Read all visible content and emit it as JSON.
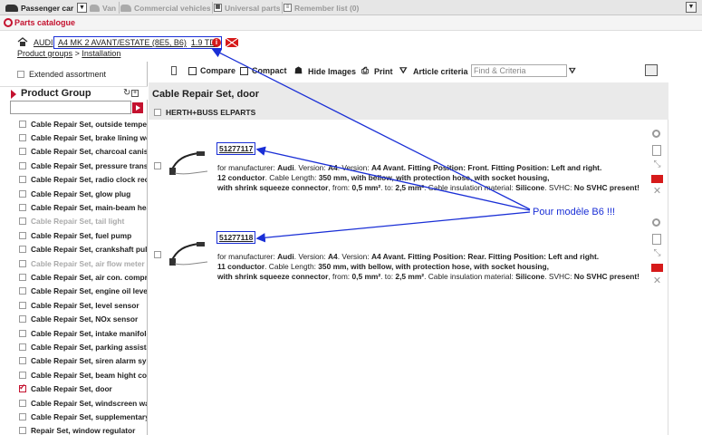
{
  "tabs": [
    {
      "label": "Passenger car",
      "active": true
    },
    {
      "label": "Van",
      "active": false
    },
    {
      "label": "Commercial vehicles",
      "active": false
    },
    {
      "label": "Universal parts",
      "active": false
    },
    {
      "label": "Remember list (0)",
      "active": false
    }
  ],
  "catalogue": {
    "label": "Parts catalogue"
  },
  "breadcrumb": {
    "make": "AUDI",
    "model": "A4 MK 2 AVANT/ESTATE (8E5, B6)",
    "engine": "1.9 TDI",
    "product_groups": "Product groups",
    "separator": ">",
    "installation": "Installation"
  },
  "sidebar": {
    "extended_assortment": "Extended assortment",
    "product_group_title": "Product Group",
    "filter_value": "",
    "items": [
      {
        "label": "Cable Repair Set, outside temperature",
        "dim": false,
        "checked": false
      },
      {
        "label": "Cable Repair Set, brake lining wear",
        "dim": false,
        "checked": false
      },
      {
        "label": "Cable Repair Set, charcoal canister",
        "dim": false,
        "checked": false
      },
      {
        "label": "Cable Repair Set, pressure transducer",
        "dim": false,
        "checked": false
      },
      {
        "label": "Cable Repair Set, radio clock receiver",
        "dim": false,
        "checked": false
      },
      {
        "label": "Cable Repair Set, glow plug",
        "dim": false,
        "checked": false
      },
      {
        "label": "Cable Repair Set, main-beam headlight",
        "dim": false,
        "checked": false
      },
      {
        "label": "Cable Repair Set, tail light",
        "dim": true,
        "checked": false
      },
      {
        "label": "Cable Repair Set, fuel pump",
        "dim": false,
        "checked": false
      },
      {
        "label": "Cable Repair Set, crankshaft pulse sensor",
        "dim": false,
        "checked": false
      },
      {
        "label": "Cable Repair Set, air flow meter",
        "dim": true,
        "checked": false
      },
      {
        "label": "Cable Repair Set, air con. compressor",
        "dim": false,
        "checked": false
      },
      {
        "label": "Cable Repair Set, engine oil level",
        "dim": false,
        "checked": false
      },
      {
        "label": "Cable Repair Set, level sensor",
        "dim": false,
        "checked": false
      },
      {
        "label": "Cable Repair Set, NOx sensor",
        "dim": false,
        "checked": false
      },
      {
        "label": "Cable Repair Set, intake manifold",
        "dim": false,
        "checked": false
      },
      {
        "label": "Cable Repair Set, parking assistant",
        "dim": false,
        "checked": false
      },
      {
        "label": "Cable Repair Set, siren alarm system",
        "dim": false,
        "checked": false
      },
      {
        "label": "Cable Repair Set, beam hight control",
        "dim": false,
        "checked": false
      },
      {
        "label": "Cable Repair Set, door",
        "dim": false,
        "checked": true
      },
      {
        "label": "Cable Repair Set, windscreen washer",
        "dim": false,
        "checked": false
      },
      {
        "label": "Cable Repair Set, supplementary",
        "dim": false,
        "checked": false
      },
      {
        "label": "Repair Set, window regulator",
        "dim": false,
        "checked": false
      }
    ]
  },
  "toolbar": {
    "compare": "Compare",
    "compact": "Compact",
    "hide_images": "Hide Images",
    "print": "Print",
    "article_criteria": "Article criteria",
    "find_placeholder": "Find & Criteria"
  },
  "article_group": {
    "title": "Cable Repair Set, door",
    "brand": "HERTH+BUSS ELPARTS"
  },
  "articles": [
    {
      "number": "51277117",
      "line1_prefix": "for manufacturer: ",
      "manufacturer": "Audi",
      "version_label": ". Version: ",
      "version": "A4",
      "version2_label": ". Version: ",
      "version2": "A4 Avant",
      "fp1_label": ". Fitting Position: ",
      "fp1": "Front",
      "fp2_label": ". Fitting Position: ",
      "fp2": "Left and right",
      "line1_end": ".",
      "conductor": "12 conductor",
      "length_label": ". Cable Length: ",
      "length": "350 mm",
      "hose": ", with bellow, with protection hose, with socket housing,",
      "shrink": "with shrink squeeze connector",
      "from_label": ", from: ",
      "from": "0,5 mm²",
      "to_label": ". to: ",
      "to": "2,5 mm²",
      "insul_label": ". Cable insulation material: ",
      "insul": "Silicone",
      "svhc_label": ". SVHC: ",
      "svhc": "No SVHC present!"
    },
    {
      "number": "51277118",
      "line1_prefix": "for manufacturer: ",
      "manufacturer": "Audi",
      "version_label": ". Version: ",
      "version": "A4",
      "version2_label": ". Version: ",
      "version2": "A4 Avant",
      "fp1_label": ". Fitting Position: ",
      "fp1": "Rear",
      "fp2_label": ". Fitting Position: ",
      "fp2": "Left and right",
      "line1_end": ".",
      "conductor": "11 conductor",
      "length_label": ". Cable Length: ",
      "length": "350 mm",
      "hose": ", with bellow, with protection hose, with socket housing,",
      "shrink": "with shrink squeeze connector",
      "from_label": ", from: ",
      "from": "0,5 mm²",
      "to_label": ". to: ",
      "to": "2,5 mm²",
      "insul_label": ". Cable insulation material: ",
      "insul": "Silicone",
      "svhc_label": ". SVHC: ",
      "svhc": "No SVHC present!"
    }
  ],
  "annotation": {
    "text": "Pour modèle B6 !!!",
    "color": "#1a2fd6"
  },
  "colors": {
    "accent": "#c4122f",
    "annotation": "#1a2fd6"
  }
}
